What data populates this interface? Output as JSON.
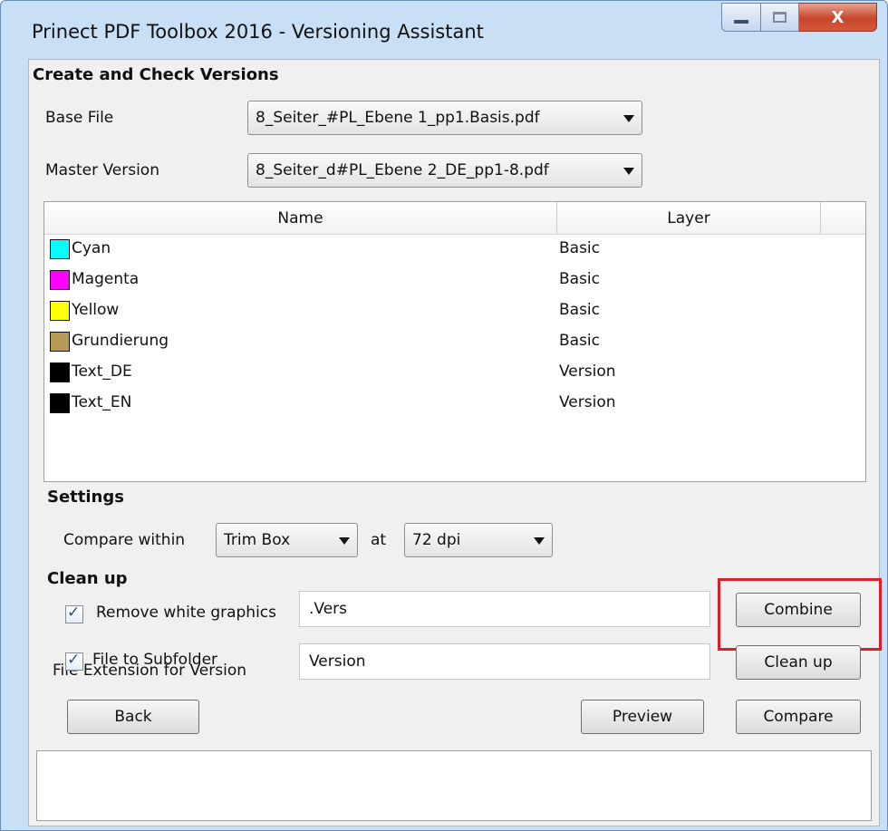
{
  "window": {
    "title": "Prinect PDF Toolbox 2016 - Versioning Assistant",
    "close_label": "X"
  },
  "create_section": {
    "header": "Create and Check Versions",
    "base_file_label": "Base File",
    "base_file_value": "8_Seiter_#PL_Ebene 1_pp1.Basis.pdf",
    "master_version_label": "Master Version",
    "master_version_value": "8_Seiter_d#PL_Ebene 2_DE_pp1-8.pdf"
  },
  "table": {
    "columns": [
      "Name",
      "Layer"
    ],
    "rows": [
      {
        "name": "Cyan",
        "layer": "Basic",
        "color": "#00ffff"
      },
      {
        "name": "Magenta",
        "layer": "Basic",
        "color": "#ff00ff"
      },
      {
        "name": "Yellow",
        "layer": "Basic",
        "color": "#ffff00"
      },
      {
        "name": "Grundierung",
        "layer": "Basic",
        "color": "#b59a58"
      },
      {
        "name": "Text_DE",
        "layer": "Version",
        "color": "#000000"
      },
      {
        "name": "Text_EN",
        "layer": "Version",
        "color": "#000000"
      }
    ]
  },
  "settings": {
    "header": "Settings",
    "compare_within_label": "Compare within",
    "box_value": "Trim Box",
    "at_label": "at",
    "dpi_value": "72 dpi"
  },
  "cleanup": {
    "header": "Clean up",
    "remove_white_label": "Remove white graphics",
    "remove_white_checked": true,
    "file_ext_label": "File Extension for Version",
    "file_ext_value": ".Vers",
    "subfolder_label": "File to Subfolder",
    "subfolder_checked": true,
    "subfolder_value": "Version"
  },
  "buttons": {
    "combine": "Combine",
    "clean_up": "Clean up",
    "back": "Back",
    "preview": "Preview",
    "compare": "Compare"
  },
  "colors": {
    "highlight": "#d9202a"
  }
}
